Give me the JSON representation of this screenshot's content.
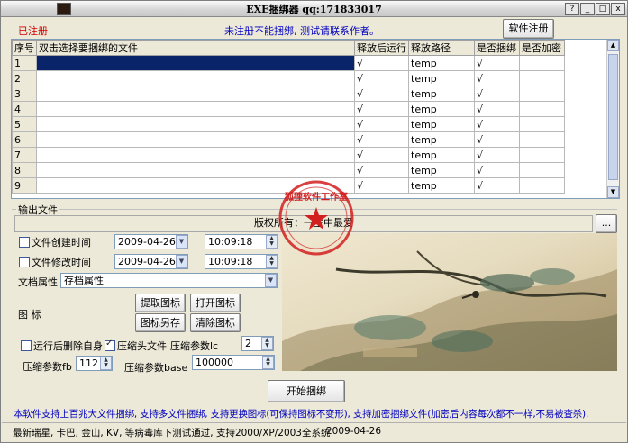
{
  "window": {
    "title": "EXE捆绑器    qq:171833017",
    "controls": [
      "?",
      "_",
      "□",
      "x"
    ]
  },
  "header": {
    "unregistered": "已注册",
    "notice": "未注册不能捆绑, 测试请联系作者。",
    "register_button": "软件注册"
  },
  "grid": {
    "columns": [
      "序号",
      "双击选择要捆绑的文件",
      "释放后运行",
      "释放路径",
      "是否捆绑",
      "是否加密"
    ],
    "rows": [
      {
        "num": "1",
        "file": "",
        "run": "√",
        "path": "temp",
        "bind": "√",
        "enc": ""
      },
      {
        "num": "2",
        "file": "",
        "run": "√",
        "path": "temp",
        "bind": "√",
        "enc": ""
      },
      {
        "num": "3",
        "file": "",
        "run": "√",
        "path": "temp",
        "bind": "√",
        "enc": ""
      },
      {
        "num": "4",
        "file": "",
        "run": "√",
        "path": "temp",
        "bind": "√",
        "enc": ""
      },
      {
        "num": "5",
        "file": "",
        "run": "√",
        "path": "temp",
        "bind": "√",
        "enc": ""
      },
      {
        "num": "6",
        "file": "",
        "run": "√",
        "path": "temp",
        "bind": "√",
        "enc": ""
      },
      {
        "num": "7",
        "file": "",
        "run": "√",
        "path": "temp",
        "bind": "√",
        "enc": ""
      },
      {
        "num": "8",
        "file": "",
        "run": "√",
        "path": "temp",
        "bind": "√",
        "enc": ""
      },
      {
        "num": "9",
        "file": "",
        "run": "√",
        "path": "temp",
        "bind": "√",
        "enc": ""
      }
    ]
  },
  "output": {
    "group_label": "输出文件",
    "path_value": "版权所有：一生中最爱",
    "browse_button": "..."
  },
  "options": {
    "create_time_label": "文件创建时间",
    "create_date": "2009-04-26",
    "create_time": "10:09:18",
    "modify_time_label": "文件修改时间",
    "modify_date": "2009-04-26",
    "modify_time": "10:09:18",
    "attr_label": "文档属性",
    "attr_value": "存档属性",
    "icon_label": "图    标",
    "extract_icon": "提取图标",
    "open_icon": "打开图标",
    "save_icon_as": "图标另存",
    "clear_icon": "清除图标",
    "delete_self_label": "运行后删除自身",
    "compress_head_label": "压缩头文件",
    "lc_label": "压缩参数lc",
    "lc_value": "2",
    "fb_label": "压缩参数fb",
    "fb_value": "112",
    "base_label": "压缩参数base",
    "base_value": "100000"
  },
  "stamp": {
    "text": "狐狸软件工作室"
  },
  "actions": {
    "start_button": "开始捆绑"
  },
  "footer": {
    "info": "本软件支持上百兆大文件捆绑, 支持多文件捆绑, 支持更换图标(可保持图标不变形), 支持加密捆绑文件(加密后内容每次都不一样,不易被查杀).",
    "av": "最新瑞星, 卡巴, 金山, KV, 等病毒库下测试通过, 支持2000/XP/2003全系统",
    "date": "2009-04-26"
  },
  "colors": {
    "accent_red": "#d00000",
    "notice_blue": "#0000c0",
    "selection": "#0a246a"
  }
}
